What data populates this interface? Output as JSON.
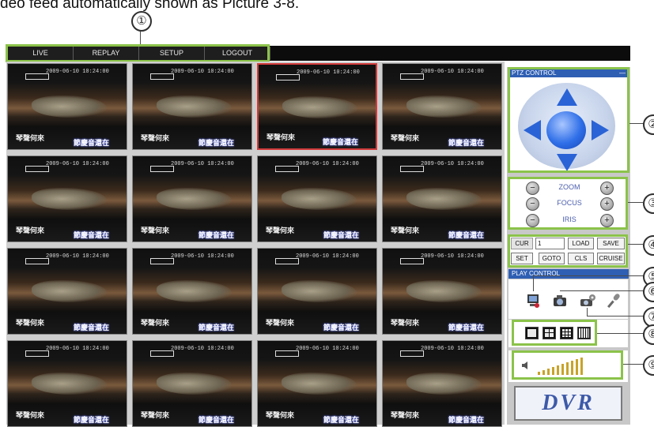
{
  "caption": "deo feed automatically shown as Picture 3-8.",
  "callouts": [
    "①",
    "②",
    "③",
    "④",
    "⑤",
    "⑥",
    "⑦",
    "⑧",
    "⑨"
  ],
  "menu": [
    {
      "label": "LIVE"
    },
    {
      "label": "REPLAY"
    },
    {
      "label": "SETUP"
    },
    {
      "label": "LOGOUT"
    }
  ],
  "grid": {
    "selected_index": 2,
    "tiles": [
      {
        "timestamp": "2009-06-10 10:24:00",
        "subtitle_left": "琴聲何來",
        "subtitle_right": "節慶音還在"
      },
      {
        "timestamp": "2009-06-10 10:24:00",
        "subtitle_left": "琴聲何來",
        "subtitle_right": "節慶音還在"
      },
      {
        "timestamp": "2009-06-10 10:24:00",
        "subtitle_left": "琴聲何來",
        "subtitle_right": "節慶音還在"
      },
      {
        "timestamp": "2009-06-10 10:24:00",
        "subtitle_left": "琴聲何來",
        "subtitle_right": "節慶音還在"
      },
      {
        "timestamp": "2009-06-10 10:24:00",
        "subtitle_left": "琴聲何來",
        "subtitle_right": "節慶音還在"
      },
      {
        "timestamp": "2009-06-10 10:24:00",
        "subtitle_left": "琴聲何來",
        "subtitle_right": "節慶音還在"
      },
      {
        "timestamp": "2009-06-10 10:24:00",
        "subtitle_left": "琴聲何來",
        "subtitle_right": "節慶音還在"
      },
      {
        "timestamp": "2009-06-10 10:24:00",
        "subtitle_left": "琴聲何來",
        "subtitle_right": "節慶音還在"
      },
      {
        "timestamp": "2009-06-10 10:24:00",
        "subtitle_left": "琴聲何來",
        "subtitle_right": "節慶音還在"
      },
      {
        "timestamp": "2009-06-10 10:24:00",
        "subtitle_left": "琴聲何來",
        "subtitle_right": "節慶音還在"
      },
      {
        "timestamp": "2009-06-10 10:24:00",
        "subtitle_left": "琴聲何來",
        "subtitle_right": "節慶音還在"
      },
      {
        "timestamp": "2009-06-10 10:24:00",
        "subtitle_left": "琴聲何來",
        "subtitle_right": "節慶音還在"
      },
      {
        "timestamp": "2009-06-10 10:24:00",
        "subtitle_left": "琴聲何來",
        "subtitle_right": "節慶音還在"
      },
      {
        "timestamp": "2009-06-10 10:24:00",
        "subtitle_left": "琴聲何來",
        "subtitle_right": "節慶音還在"
      },
      {
        "timestamp": "2009-06-10 10:24:00",
        "subtitle_left": "琴聲何來",
        "subtitle_right": "節慶音還在"
      },
      {
        "timestamp": "2009-06-10 10:24:00",
        "subtitle_left": "琴聲何來",
        "subtitle_right": "節慶音還在"
      }
    ]
  },
  "ptz": {
    "title": "PTZ CONTROL",
    "minimize_glyph": "—"
  },
  "lens": {
    "zoom": "ZOOM",
    "focus": "FOCUS",
    "iris": "IRIS",
    "minus": "−",
    "plus": "+"
  },
  "preset": {
    "cur_label": "CUR",
    "cur_value": "1",
    "load": "LOAD",
    "save": "SAVE",
    "set": "SET",
    "goto": "GOTO",
    "cls": "CLS",
    "cruise": "CRUISE"
  },
  "play": {
    "title": "PLAY CONTROL",
    "icons": [
      "record-icon",
      "snapshot-icon",
      "camera-settings-icon",
      "intercom-icon"
    ]
  },
  "split_modes": [
    "1-screen",
    "4-screen",
    "9-screen",
    "16-screen"
  ],
  "volume": {
    "level": 10,
    "max": 10,
    "icon": "speaker-icon"
  },
  "logo": "DVR",
  "colors": {
    "highlight": "#8bc34a",
    "panel_header": "#2f5fb3",
    "ptz_blue": "#2a63d6",
    "selected_border": "#d23b3b"
  }
}
